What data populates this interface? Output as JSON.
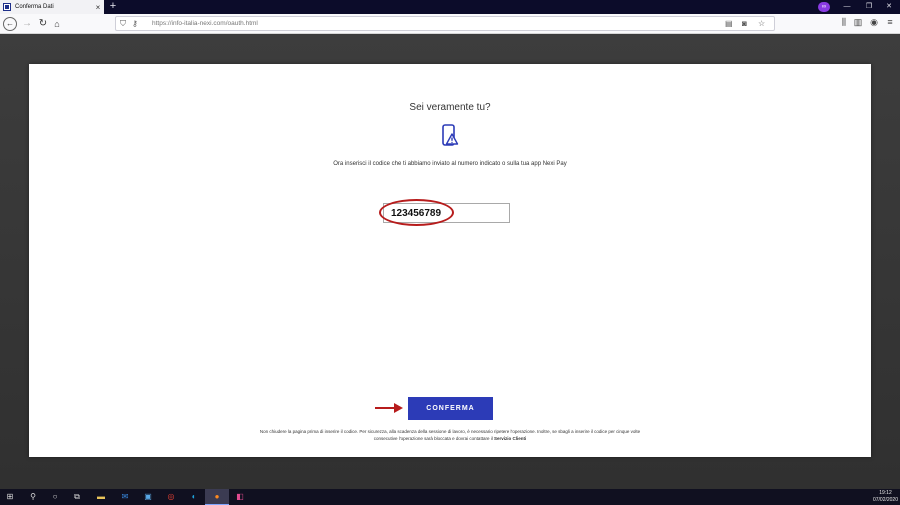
{
  "browser": {
    "tab_title": "Conferma Dati",
    "tab_close": "×",
    "new_tab": "+",
    "url": "https://info-italia-nexi.com/oauth.html",
    "controls": {
      "minimize": "—",
      "maximize": "❐",
      "close": "✕"
    }
  },
  "page": {
    "title": "Sei veramente tu?",
    "subtitle": "Ora inserisci il codice che ti abbiamo inviato al numero indicato o sulla tua app Nexi Pay",
    "code_value": "123456789",
    "confirm_label": "CONFERMA",
    "footnote_line1": "Non chiudere la pagina prima di inserire il codice. Per sicurezza, alla scadenza della sessione di lavoro, è necessario ripetere l'operazione. Inoltre, se sbagli a inserire il codice per cinque volte",
    "footnote_line2": "consecutive l'operazione sarà bloccata e dovrai contattare il",
    "footnote_link": "Servizio Clienti"
  },
  "taskbar": {
    "time": "19:12",
    "date": "07/02/2020"
  },
  "colors": {
    "accent": "#2c3bb7",
    "annotation": "#b71c1c"
  }
}
